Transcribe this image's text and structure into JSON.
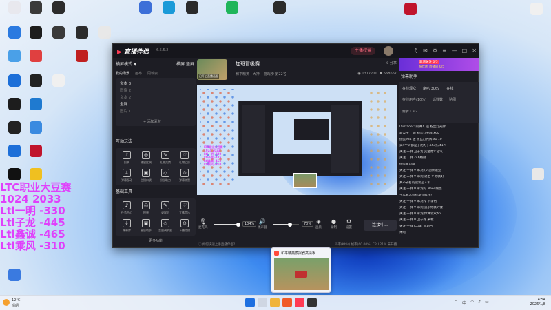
{
  "desktop_icons": [
    {
      "label": "",
      "color": "#e8e8ee"
    },
    {
      "label": "",
      "color": "#3a3a3a"
    },
    {
      "label": "",
      "color": "#2c2c2c"
    },
    {
      "label": "",
      "color": "#3c6fd8"
    },
    {
      "label": "",
      "color": "#1a9ad8"
    },
    {
      "label": "",
      "color": "#2a2a2a"
    },
    {
      "label": "",
      "color": "#1fb55a"
    },
    {
      "label": "",
      "color": "#2b2b2b"
    },
    {
      "label": "",
      "color": "#c0142c"
    },
    {
      "label": "",
      "color": "#f0f0f0"
    }
  ],
  "overlay_lines": [
    "LTC职业大豆赛",
    "1024 2033",
    "Ltl一明 -330",
    "Ltl子龙 -445",
    "Ltl鑫诚 -465",
    "Ltl乘风 -310"
  ],
  "app": {
    "logo_main": "直播伴侣",
    "version": "6.5.5.2",
    "live_button": "主播权益",
    "left_panel": {
      "mode_label": "横屏模式 ▼",
      "mode_options": [
        "横屏",
        "竖屏"
      ],
      "tabs": [
        "我的场景",
        "画布",
        "同城会"
      ],
      "sources": [
        "文本 3",
        "图像 2",
        "文本 2",
        "全屏",
        "图片 1"
      ],
      "add_source": "+ 添加素材",
      "interaction_title": "互动玩法",
      "interaction_items": [
        "投票",
        "播放比例",
        "礼物竞猜",
        "礼物心愿",
        "弹幕互动",
        "主播口袋",
        "粉丝助力",
        "弹幕点赞"
      ],
      "tools_title": "基础工具",
      "tools_items": [
        "任务中心",
        "抢单",
        "录屏机",
        "立体音乐",
        "弹幕库",
        "画质助手",
        "音量调节器",
        "下播综控"
      ],
      "more": "更多功能"
    },
    "room": {
      "thumb_label": "已开启直播画面",
      "title": "加班冒吸赛",
      "meta": [
        "和平精英 · 大神",
        "游戏榜 第22名"
      ],
      "share": "分享",
      "views": "1317700",
      "likes": "568667"
    },
    "preview_mini_lines": [
      "LTC职业大豆赛",
      "1024 2033",
      "Ltl一明 -330",
      "Ltl子龙 -445",
      "Ltl鑫诚 -465",
      "Ltl乘风 -310"
    ],
    "controls": {
      "mic_label": "麦克风",
      "mic_pct": "104%",
      "speaker_label": "扬声器",
      "speaker_pct": "70%",
      "mic_level": 0.95,
      "speaker_level": 0.65,
      "btns": [
        "画质",
        "录制",
        "设置"
      ],
      "start": "连接中..."
    },
    "status": {
      "left": "如何快速上手直播伴侣？",
      "right": "码率(Kb/s) 帧率(60.00%) CPU 21% 未开播"
    },
    "right_panel": {
      "promo_tag": "新增关注 0/5",
      "promo_text": "粉丝团 直播间 0/5",
      "assistant": "弹幕助手",
      "tabs": [
        "在线观众",
        "喇叭 3069",
        "在线"
      ],
      "tabs2": [
        "在线用户(10%)",
        "话数数",
        "贴图"
      ],
      "line4": "剩余:1.9.2",
      "messages": [
        "Dustader: 闹钟人 送 粉丝灯光牌",
        "新公子了 送 粉丝灯光牌 x60",
        "捌蛋984 送 粉丝灯光牌 x1 10",
        "实4个头都是子龙的 | 443条/41人",
        "关注 一群 卫子龙 吴金亦年轻气",
        "关注 二群 Zi 6婚赫",
        "捌蛋家边境",
        "关注 一群 ♀ 彩泡 (0)韵传遗见",
        "关注 二群 ♀ 彩泡 进出 ♀ 你真好",
        "真不去打的说谈是人机",
        "关注 一群 ♀ 彩泡 ♀ Need网慢",
        "今年真人机有没有疯狂?",
        "关注 一群 ♀ 彩泡 ♀ 机争柯",
        "关注 一群 ♀ 彩泡 追求你真的傻",
        "关注 一群 ♀ 彩泡 你真欢欢An",
        "关注 一群 ♀ 卫子龙 来啦",
        "关注 一群 (二群) 三洞回",
        "来啦"
      ]
    }
  },
  "tooltip": {
    "title": "和平精英模拟器高清板"
  },
  "taskbar": {
    "temp": "12°C",
    "weather": "晴朗",
    "time": "14:54",
    "date": "2026/1/8"
  }
}
